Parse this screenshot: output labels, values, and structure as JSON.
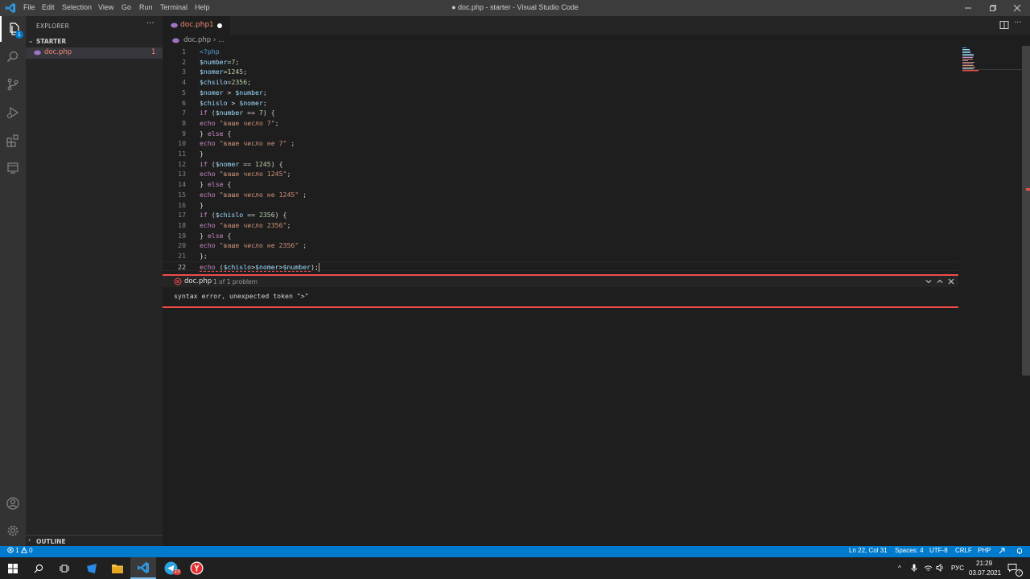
{
  "window": {
    "title": "● doc.php - starter - Visual Studio Code",
    "menu": [
      "File",
      "Edit",
      "Selection",
      "View",
      "Go",
      "Run",
      "Terminal",
      "Help"
    ]
  },
  "activity_bar": {
    "explorer_badge": "1"
  },
  "sidebar": {
    "title": "EXPLORER",
    "more": "···",
    "folder": "STARTER",
    "files": [
      {
        "name": "doc.php",
        "problems": "1"
      }
    ],
    "outline": "OUTLINE"
  },
  "tab": {
    "label": "doc.php",
    "problems": "1",
    "more": "···"
  },
  "breadcrumb": {
    "file": "doc.php",
    "separator": "›",
    "ellipsis": "..."
  },
  "colors": {
    "keyword": "#c586c0",
    "variable": "#9cdcfe",
    "string": "#ce9178",
    "number": "#b5cea8",
    "tag": "#569cd6",
    "text": "#d4d4d4",
    "error": "#f14c4c",
    "statusbar": "#007acc"
  },
  "code": [
    {
      "n": "1",
      "tokens": [
        {
          "t": "<?php",
          "c": "tag"
        }
      ]
    },
    {
      "n": "2",
      "tokens": [
        {
          "t": "$number",
          "c": "variable"
        },
        {
          "t": "=",
          "c": "text"
        },
        {
          "t": "7",
          "c": "number"
        },
        {
          "t": ";",
          "c": "text"
        }
      ]
    },
    {
      "n": "3",
      "tokens": [
        {
          "t": "$nomer",
          "c": "variable"
        },
        {
          "t": "=",
          "c": "text"
        },
        {
          "t": "1245",
          "c": "number"
        },
        {
          "t": ";",
          "c": "text"
        }
      ]
    },
    {
      "n": "4",
      "tokens": [
        {
          "t": "$chsilo",
          "c": "variable"
        },
        {
          "t": "=",
          "c": "text"
        },
        {
          "t": "2356",
          "c": "number"
        },
        {
          "t": ";",
          "c": "text"
        }
      ]
    },
    {
      "n": "5",
      "tokens": [
        {
          "t": "$nomer",
          "c": "variable"
        },
        {
          "t": " > ",
          "c": "text"
        },
        {
          "t": "$number",
          "c": "variable"
        },
        {
          "t": ";",
          "c": "text"
        }
      ]
    },
    {
      "n": "6",
      "tokens": [
        {
          "t": "$chislo",
          "c": "variable"
        },
        {
          "t": " > ",
          "c": "text"
        },
        {
          "t": "$nomer",
          "c": "variable"
        },
        {
          "t": ";",
          "c": "text"
        }
      ]
    },
    {
      "n": "7",
      "tokens": [
        {
          "t": "if",
          "c": "keyword"
        },
        {
          "t": " (",
          "c": "text"
        },
        {
          "t": "$number",
          "c": "variable"
        },
        {
          "t": " == ",
          "c": "text"
        },
        {
          "t": "7",
          "c": "number"
        },
        {
          "t": ") {",
          "c": "text"
        }
      ]
    },
    {
      "n": "8",
      "tokens": [
        {
          "t": "echo",
          "c": "keyword"
        },
        {
          "t": " ",
          "c": "text"
        },
        {
          "t": "\"ваше число 7\"",
          "c": "string"
        },
        {
          "t": ";",
          "c": "text"
        }
      ]
    },
    {
      "n": "9",
      "tokens": [
        {
          "t": "} ",
          "c": "text"
        },
        {
          "t": "else",
          "c": "keyword"
        },
        {
          "t": " {",
          "c": "text"
        }
      ]
    },
    {
      "n": "10",
      "tokens": [
        {
          "t": "echo",
          "c": "keyword"
        },
        {
          "t": " ",
          "c": "text"
        },
        {
          "t": "\"ваше число не 7\"",
          "c": "string"
        },
        {
          "t": " ;",
          "c": "text"
        }
      ]
    },
    {
      "n": "11",
      "tokens": [
        {
          "t": "}",
          "c": "text"
        }
      ]
    },
    {
      "n": "12",
      "tokens": [
        {
          "t": "if",
          "c": "keyword"
        },
        {
          "t": " (",
          "c": "text"
        },
        {
          "t": "$nomer",
          "c": "variable"
        },
        {
          "t": " == ",
          "c": "text"
        },
        {
          "t": "1245",
          "c": "number"
        },
        {
          "t": ") {",
          "c": "text"
        }
      ]
    },
    {
      "n": "13",
      "tokens": [
        {
          "t": "echo",
          "c": "keyword"
        },
        {
          "t": " ",
          "c": "text"
        },
        {
          "t": "\"ваше число 1245\"",
          "c": "string"
        },
        {
          "t": ";",
          "c": "text"
        }
      ]
    },
    {
      "n": "14",
      "tokens": [
        {
          "t": "} ",
          "c": "text"
        },
        {
          "t": "else",
          "c": "keyword"
        },
        {
          "t": " {",
          "c": "text"
        }
      ]
    },
    {
      "n": "15",
      "tokens": [
        {
          "t": "echo",
          "c": "keyword"
        },
        {
          "t": " ",
          "c": "text"
        },
        {
          "t": "\"ваше число не 1245\"",
          "c": "string"
        },
        {
          "t": " ;",
          "c": "text"
        }
      ]
    },
    {
      "n": "16",
      "tokens": [
        {
          "t": "}",
          "c": "text"
        }
      ]
    },
    {
      "n": "17",
      "tokens": [
        {
          "t": "if",
          "c": "keyword"
        },
        {
          "t": " (",
          "c": "text"
        },
        {
          "t": "$chislo",
          "c": "variable"
        },
        {
          "t": " == ",
          "c": "text"
        },
        {
          "t": "2356",
          "c": "number"
        },
        {
          "t": ") {",
          "c": "text"
        }
      ]
    },
    {
      "n": "18",
      "tokens": [
        {
          "t": "echo",
          "c": "keyword"
        },
        {
          "t": " ",
          "c": "text"
        },
        {
          "t": "\"ваше число 2356\"",
          "c": "string"
        },
        {
          "t": ";",
          "c": "text"
        }
      ]
    },
    {
      "n": "19",
      "tokens": [
        {
          "t": "} ",
          "c": "text"
        },
        {
          "t": "else",
          "c": "keyword"
        },
        {
          "t": " {",
          "c": "text"
        }
      ]
    },
    {
      "n": "20",
      "tokens": [
        {
          "t": "echo",
          "c": "keyword"
        },
        {
          "t": " ",
          "c": "text"
        },
        {
          "t": "\"ваше число не 2356\"",
          "c": "string"
        },
        {
          "t": " ;",
          "c": "text"
        }
      ]
    },
    {
      "n": "21",
      "tokens": [
        {
          "t": "};",
          "c": "text"
        }
      ]
    },
    {
      "n": "22",
      "tokens": [
        {
          "t": "echo",
          "c": "keyword"
        },
        {
          "t": " (",
          "c": "text"
        },
        {
          "t": "$chislo",
          "c": "variable"
        },
        {
          "t": ">",
          "c": "text"
        },
        {
          "t": "$nomer",
          "c": "variable"
        },
        {
          "t": ">",
          "c": "text"
        },
        {
          "t": "$number",
          "c": "variable"
        },
        {
          "t": ");",
          "c": "text"
        }
      ]
    }
  ],
  "current_line": "22",
  "problem_peek": {
    "file": "doc.php",
    "count": "1 of 1 problem",
    "message": "syntax error, unexpected token \">\""
  },
  "status_bar": {
    "errors": "1",
    "warnings": "0",
    "position": "Ln 22, Col 31",
    "spaces": "Spaces: 4",
    "encoding": "UTF-8",
    "eol": "CRLF",
    "language": "PHP"
  },
  "taskbar": {
    "language": "РУС",
    "time": "21:29",
    "date": "03.07.2021",
    "notifications": "7",
    "telegram_badge": "23"
  }
}
